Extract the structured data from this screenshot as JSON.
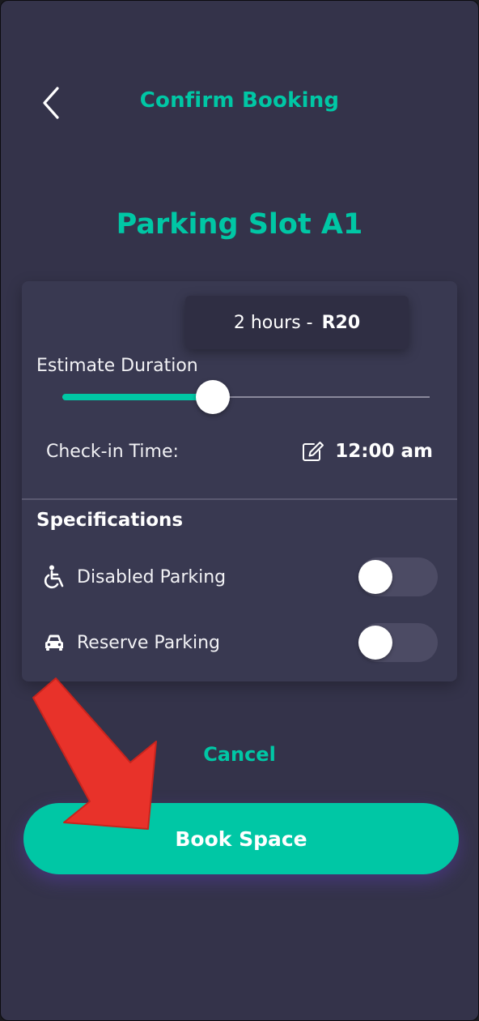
{
  "header": {
    "title": "Confirm Booking",
    "back_icon": "chevron-left-icon"
  },
  "slot": {
    "title": "Parking Slot A1"
  },
  "duration": {
    "hours_text": "2 hours - ",
    "price_text": "R20",
    "label": "Estimate Duration",
    "slider_fraction": 0.41
  },
  "checkin": {
    "label": "Check-in Time:",
    "value": "12:00 am",
    "icon": "edit-icon"
  },
  "specifications": {
    "heading": "Specifications",
    "items": [
      {
        "label": "Disabled Parking",
        "icon": "wheelchair-icon",
        "enabled": false
      },
      {
        "label": "Reserve Parking",
        "icon": "car-icon",
        "enabled": false
      }
    ]
  },
  "actions": {
    "cancel_label": "Cancel",
    "book_label": "Book Space"
  },
  "colors": {
    "background": "#34334a",
    "card": "#393951",
    "accent": "#00c7a5",
    "annotation_arrow": "#e8322a"
  }
}
